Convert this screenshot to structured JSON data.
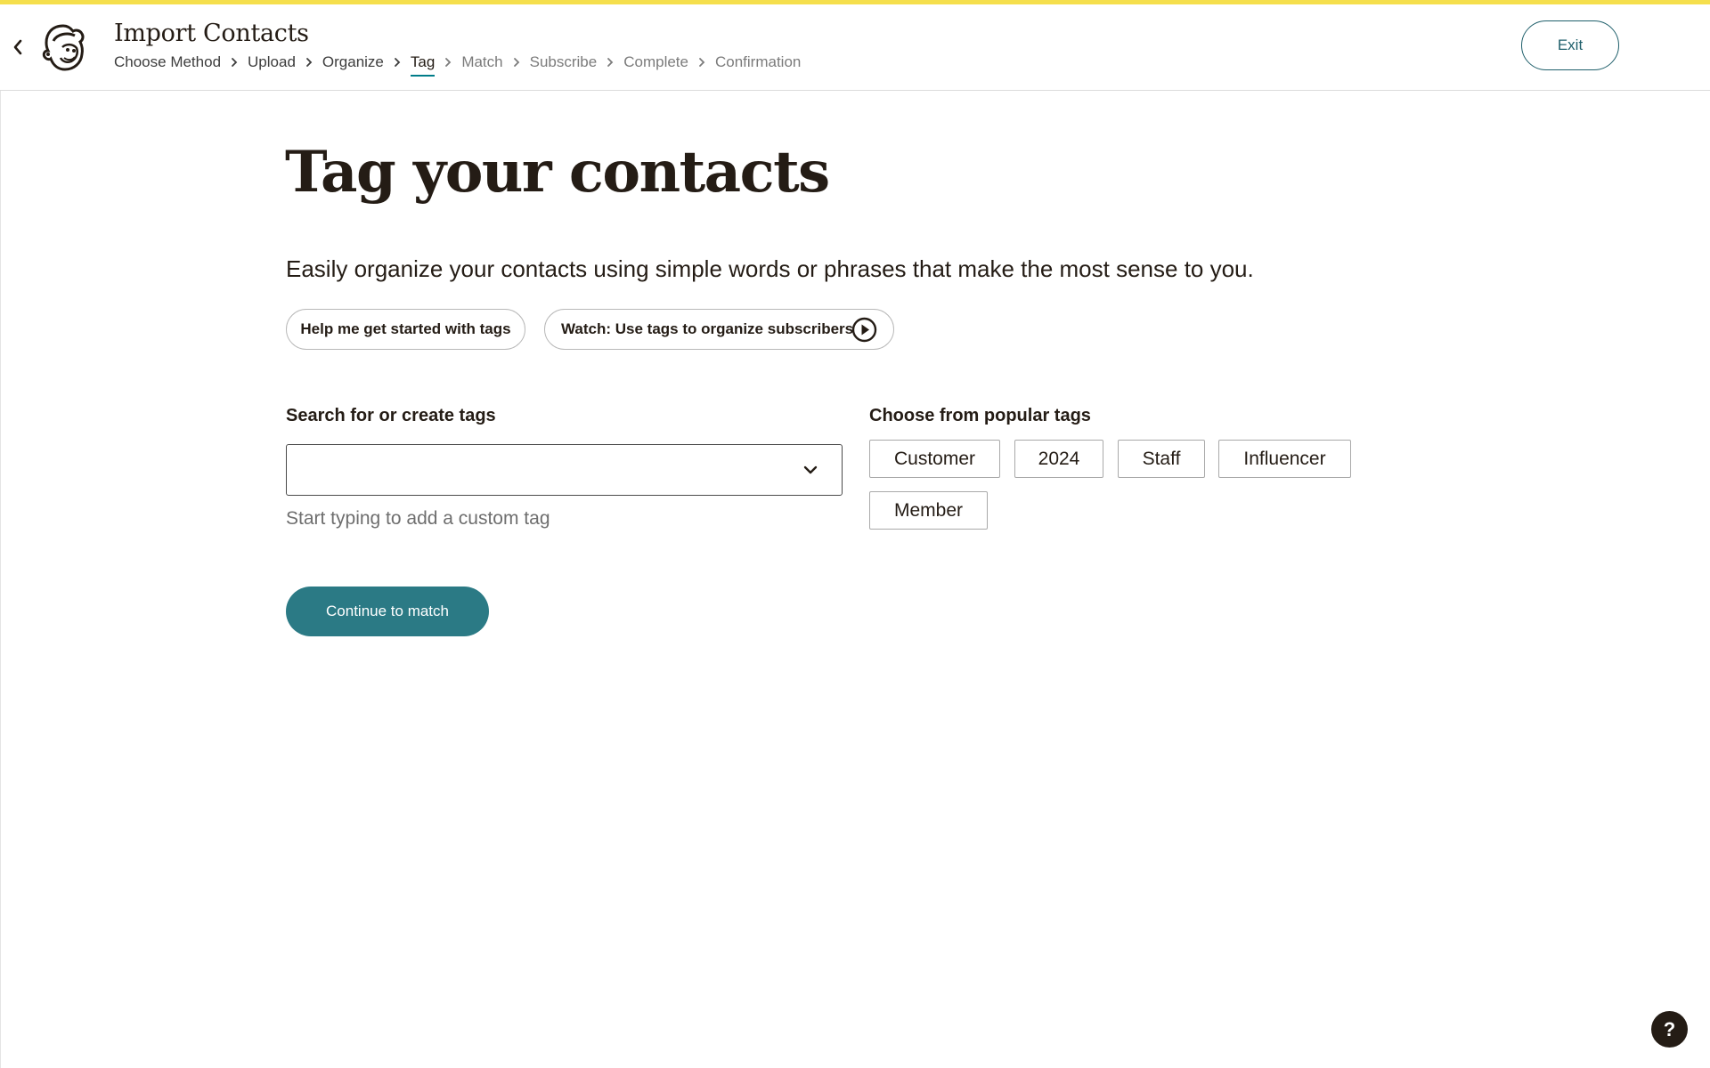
{
  "colors": {
    "accent_bar": "#f5df4d",
    "primary_teal": "#2b7a85",
    "exit_text": "#1f5f6b",
    "active_underline": "#007c89",
    "text_dark": "#241c15"
  },
  "header": {
    "title": "Import Contacts",
    "back_icon": "chevron-left-icon",
    "logo_icon": "freddie-monkey-logo",
    "exit_label": "Exit",
    "breadcrumb": [
      {
        "label": "Choose Method",
        "state": "done"
      },
      {
        "label": "Upload",
        "state": "done"
      },
      {
        "label": "Organize",
        "state": "done"
      },
      {
        "label": "Tag",
        "state": "current"
      },
      {
        "label": "Match",
        "state": "future"
      },
      {
        "label": "Subscribe",
        "state": "future"
      },
      {
        "label": "Complete",
        "state": "future"
      },
      {
        "label": "Confirmation",
        "state": "future"
      }
    ]
  },
  "main": {
    "title": "Tag your contacts",
    "intro": "Easily organize your contacts using simple words or phrases that make the most sense to you.",
    "help_button": "Help me get started with tags",
    "watch_button": "Watch: Use tags to organize subscribers",
    "watch_icon": "play-circle-icon",
    "search": {
      "label": "Search for or create tags",
      "value": "",
      "placeholder": "",
      "hint": "Start typing to add a custom tag",
      "dropdown_icon": "chevron-down-icon"
    },
    "popular": {
      "label": "Choose from popular tags",
      "tags": [
        "Customer",
        "2024",
        "Staff",
        "Influencer",
        "Member"
      ]
    },
    "continue_button": "Continue to match"
  },
  "help_fab": "?"
}
